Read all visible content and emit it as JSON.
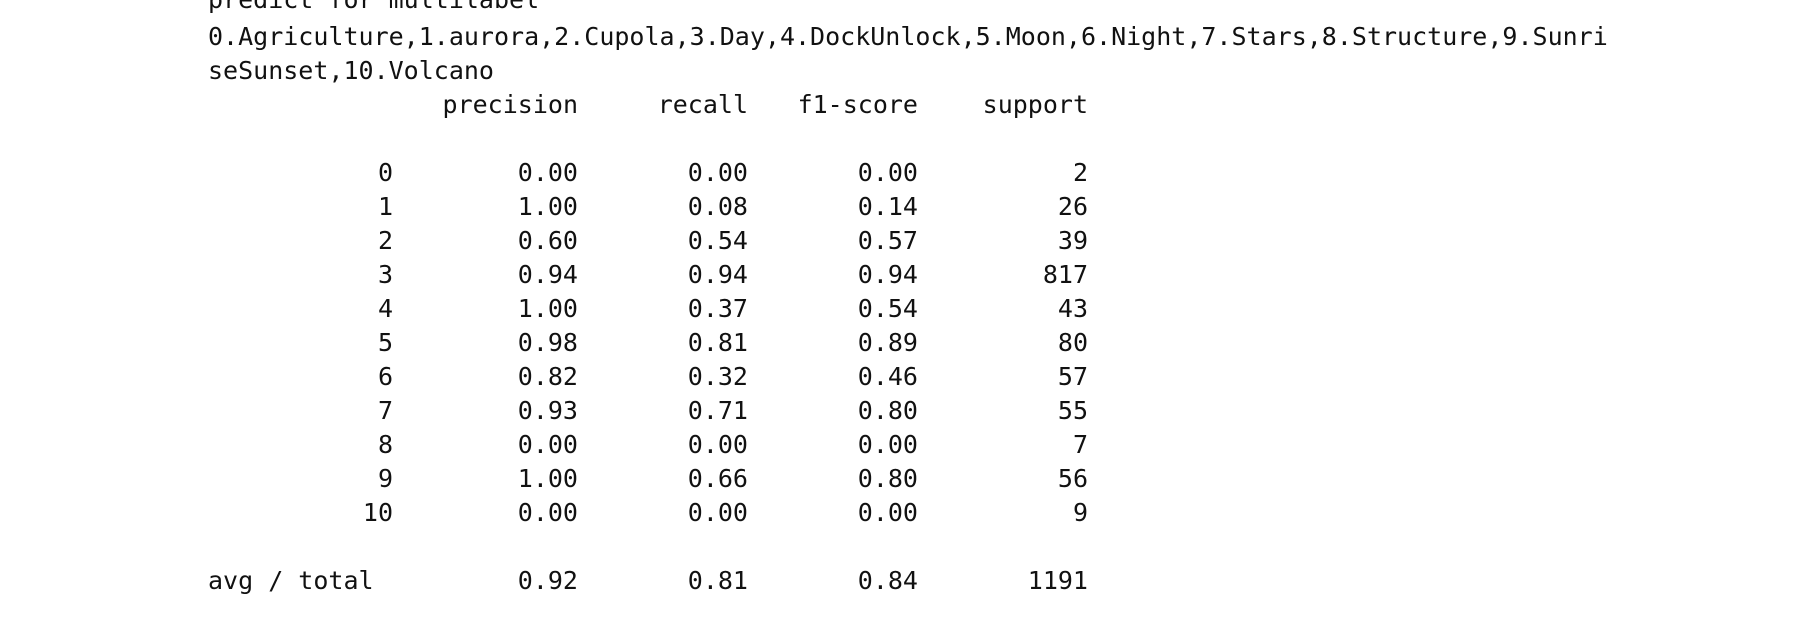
{
  "output": {
    "title": "predict for multilabel",
    "class_names_line1": "0.Agriculture,1.aurora,2.Cupola,3.Day,4.DockUnlock,5.Moon,6.Night,7.Stars,8.Structure,9.Sunri",
    "class_names_line2": "seSunset,10.Volcano"
  },
  "report": {
    "headers": {
      "precision": "precision",
      "recall": "recall",
      "f1": "f1-score",
      "support": "support"
    },
    "rows": [
      {
        "label": "0",
        "precision": "0.00",
        "recall": "0.00",
        "f1": "0.00",
        "support": "2"
      },
      {
        "label": "1",
        "precision": "1.00",
        "recall": "0.08",
        "f1": "0.14",
        "support": "26"
      },
      {
        "label": "2",
        "precision": "0.60",
        "recall": "0.54",
        "f1": "0.57",
        "support": "39"
      },
      {
        "label": "3",
        "precision": "0.94",
        "recall": "0.94",
        "f1": "0.94",
        "support": "817"
      },
      {
        "label": "4",
        "precision": "1.00",
        "recall": "0.37",
        "f1": "0.54",
        "support": "43"
      },
      {
        "label": "5",
        "precision": "0.98",
        "recall": "0.81",
        "f1": "0.89",
        "support": "80"
      },
      {
        "label": "6",
        "precision": "0.82",
        "recall": "0.32",
        "f1": "0.46",
        "support": "57"
      },
      {
        "label": "7",
        "precision": "0.93",
        "recall": "0.71",
        "f1": "0.80",
        "support": "55"
      },
      {
        "label": "8",
        "precision": "0.00",
        "recall": "0.00",
        "f1": "0.00",
        "support": "7"
      },
      {
        "label": "9",
        "precision": "1.00",
        "recall": "0.66",
        "f1": "0.80",
        "support": "56"
      },
      {
        "label": "10",
        "precision": "0.00",
        "recall": "0.00",
        "f1": "0.00",
        "support": "9"
      }
    ],
    "total": {
      "label": "avg / total",
      "precision": "0.92",
      "recall": "0.81",
      "f1": "0.84",
      "support": "1191"
    }
  }
}
